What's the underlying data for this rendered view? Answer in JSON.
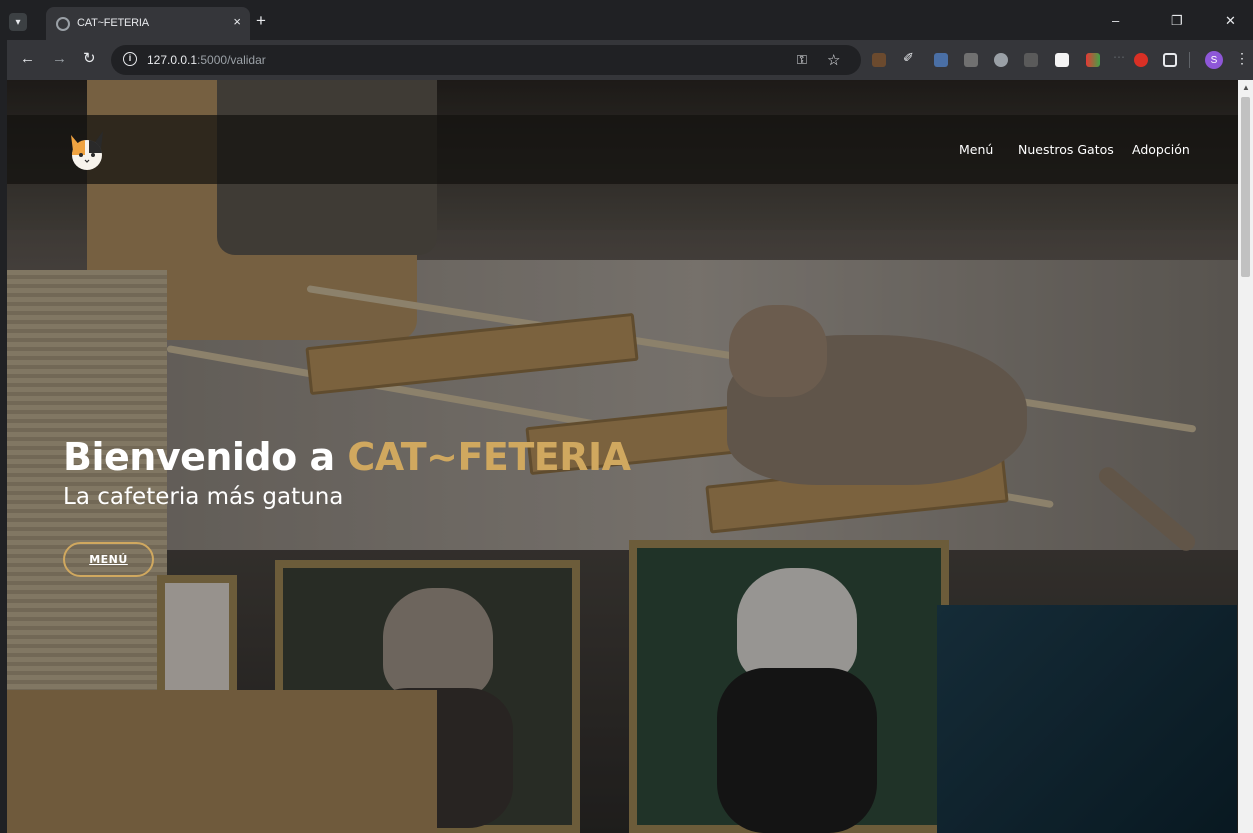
{
  "browser": {
    "tab_title": "CAT~FETERIA",
    "tab_close": "×",
    "new_tab": "+",
    "url_host": "127.0.0.1",
    "url_path": ":5000/validar",
    "profile_initial": "S",
    "window_controls": [
      "–",
      "❐",
      "✕"
    ]
  },
  "site": {
    "nav": [
      "Menú",
      "Nuestros Gatos",
      "Adopción"
    ],
    "hero": {
      "title_prefix": "Bienvenido a ",
      "title_brand": "CAT~FETERIA",
      "subtitle": "La cafeteria más gatuna",
      "button": "MENÚ"
    },
    "colors": {
      "brand_gold": "#d0a85f",
      "header_bg": "#14120f"
    }
  }
}
